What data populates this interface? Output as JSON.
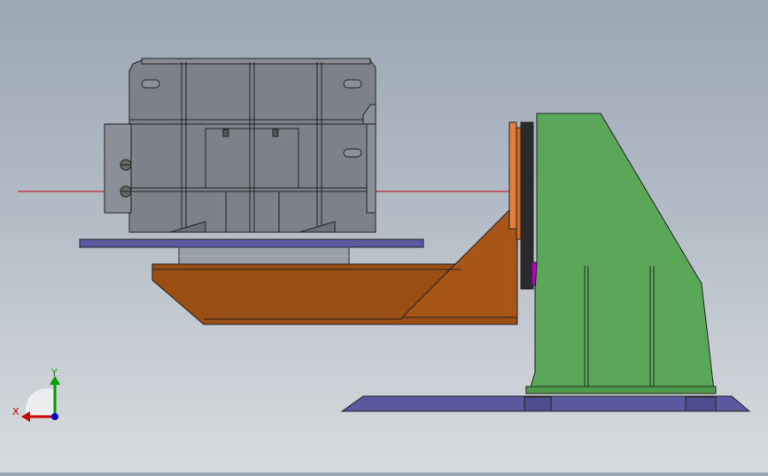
{
  "viewport": {
    "background_top": "#9aa7b5",
    "background_bottom": "#d9dcdf"
  },
  "model": {
    "gearbox_color": "#7c818a",
    "table_color": "#5a5aa0",
    "arm_color": "#9a4e12",
    "column_color": "#5aa857",
    "flange_color": "#e0803a",
    "hub_color": "#b000c0",
    "axis_line_color": "#c00000"
  },
  "triad": {
    "x_label": "X",
    "y_label": "Y",
    "x_color": "#cc0000",
    "y_color": "#00a000",
    "z_color": "#0000cc"
  }
}
